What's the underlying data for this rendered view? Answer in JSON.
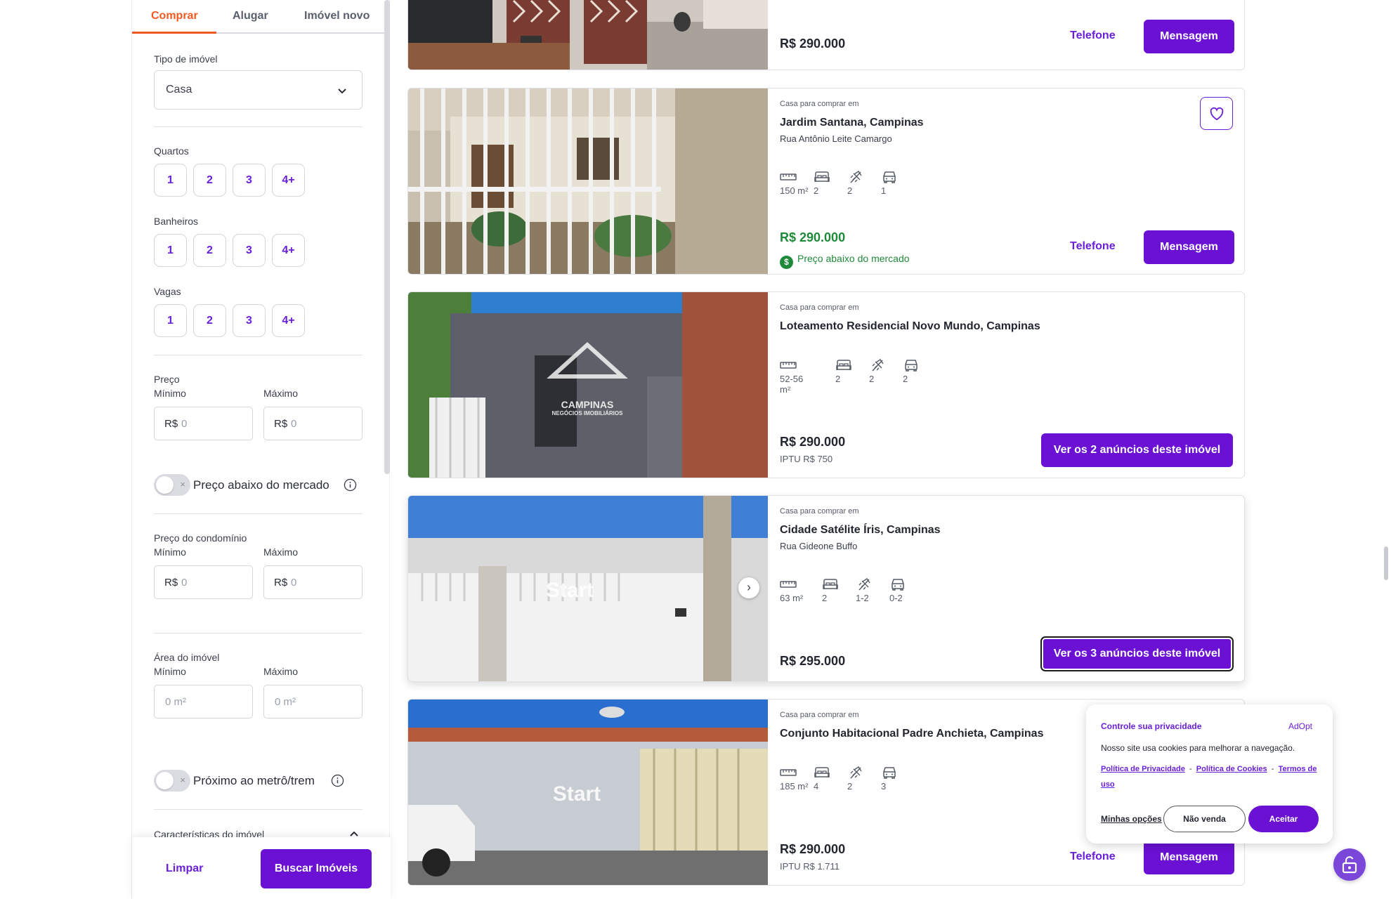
{
  "tabs": [
    "Comprar",
    "Alugar",
    "Imóvel novo"
  ],
  "filters": {
    "property_type_label": "Tipo de imóvel",
    "property_type_value": "Casa",
    "bedrooms_label": "Quartos",
    "bathrooms_label": "Banheiros",
    "parking_label": "Vagas",
    "options": [
      "1",
      "2",
      "3",
      "4+"
    ],
    "price_label": "Preço",
    "min_label": "Mínimo",
    "max_label": "Máximo",
    "currency": "R$",
    "zero": "0",
    "below_market_label": "Preço abaixo do mercado",
    "condo_label": "Preço do condomínio",
    "area_label": "Área do imóvel",
    "area_placeholder": "0 m²",
    "metro_label": "Próximo ao metrô/trem",
    "features_label": "Características do imóvel",
    "toggle_off": "×",
    "clear_button": "Limpar",
    "search_button": "Buscar Imóveis"
  },
  "listings": [
    {
      "price": "R$ 290.000",
      "phone_label": "Telefone",
      "message_label": "Mensagem"
    },
    {
      "kind": "Casa para comprar em",
      "title": "Jardim Santana, Campinas",
      "street": "Rua Antônio Leite Camargo",
      "area": "150 m²",
      "bedrooms": "2",
      "bathrooms": "2",
      "parking": "1",
      "price": "R$ 290.000",
      "badge": "Preço abaixo do mercado",
      "badge_symbol": "$",
      "phone_label": "Telefone",
      "message_label": "Mensagem"
    },
    {
      "kind": "Casa para comprar em",
      "title": "Loteamento Residencial Novo Mundo, Campinas",
      "area": "52-56 m²",
      "bedrooms": "2",
      "bathrooms": "2",
      "parking": "2",
      "price": "R$ 290.000",
      "iptu": "IPTU R$ 750",
      "ads_label": "Ver os 2 anúncios deste imóvel",
      "watermark_line1": "CAMPINAS",
      "watermark_line2": "NEGÓCIOS IMOBILIÁRIOS"
    },
    {
      "kind": "Casa para comprar em",
      "title": "Cidade Satélite Íris, Campinas",
      "street": "Rua Gideone Buffo",
      "area": "63 m²",
      "bedrooms": "2",
      "bathrooms": "1-2",
      "parking": "0-2",
      "price": "R$ 295.000",
      "ads_label": "Ver os 3 anúncios deste imóvel",
      "watermark": "Start"
    },
    {
      "kind": "Casa para comprar em",
      "title": "Conjunto Habitacional Padre Anchieta, Campinas",
      "area": "185 m²",
      "bedrooms": "4",
      "bathrooms": "2",
      "parking": "3",
      "price": "R$ 290.000",
      "iptu": "IPTU R$ 1.711",
      "phone_label": "Telefone",
      "message_label": "Mensagem",
      "watermark": "Start"
    }
  ],
  "cookie": {
    "title": "Controle sua privacidade",
    "brand": "AdOpt",
    "text": "Nosso site usa cookies para melhorar a navegação.",
    "privacy_link": "Política de Privacidade",
    "cookies_link": "Política de Cookies",
    "terms_link": "Termos de uso",
    "separator": "-",
    "options_label": "Minhas opções",
    "reject_label": "Não venda",
    "accept_label": "Aceitar"
  },
  "colors": {
    "accent": "#6a11d4",
    "tab_active": "#f05a22",
    "below_market": "#1f8a3a"
  }
}
